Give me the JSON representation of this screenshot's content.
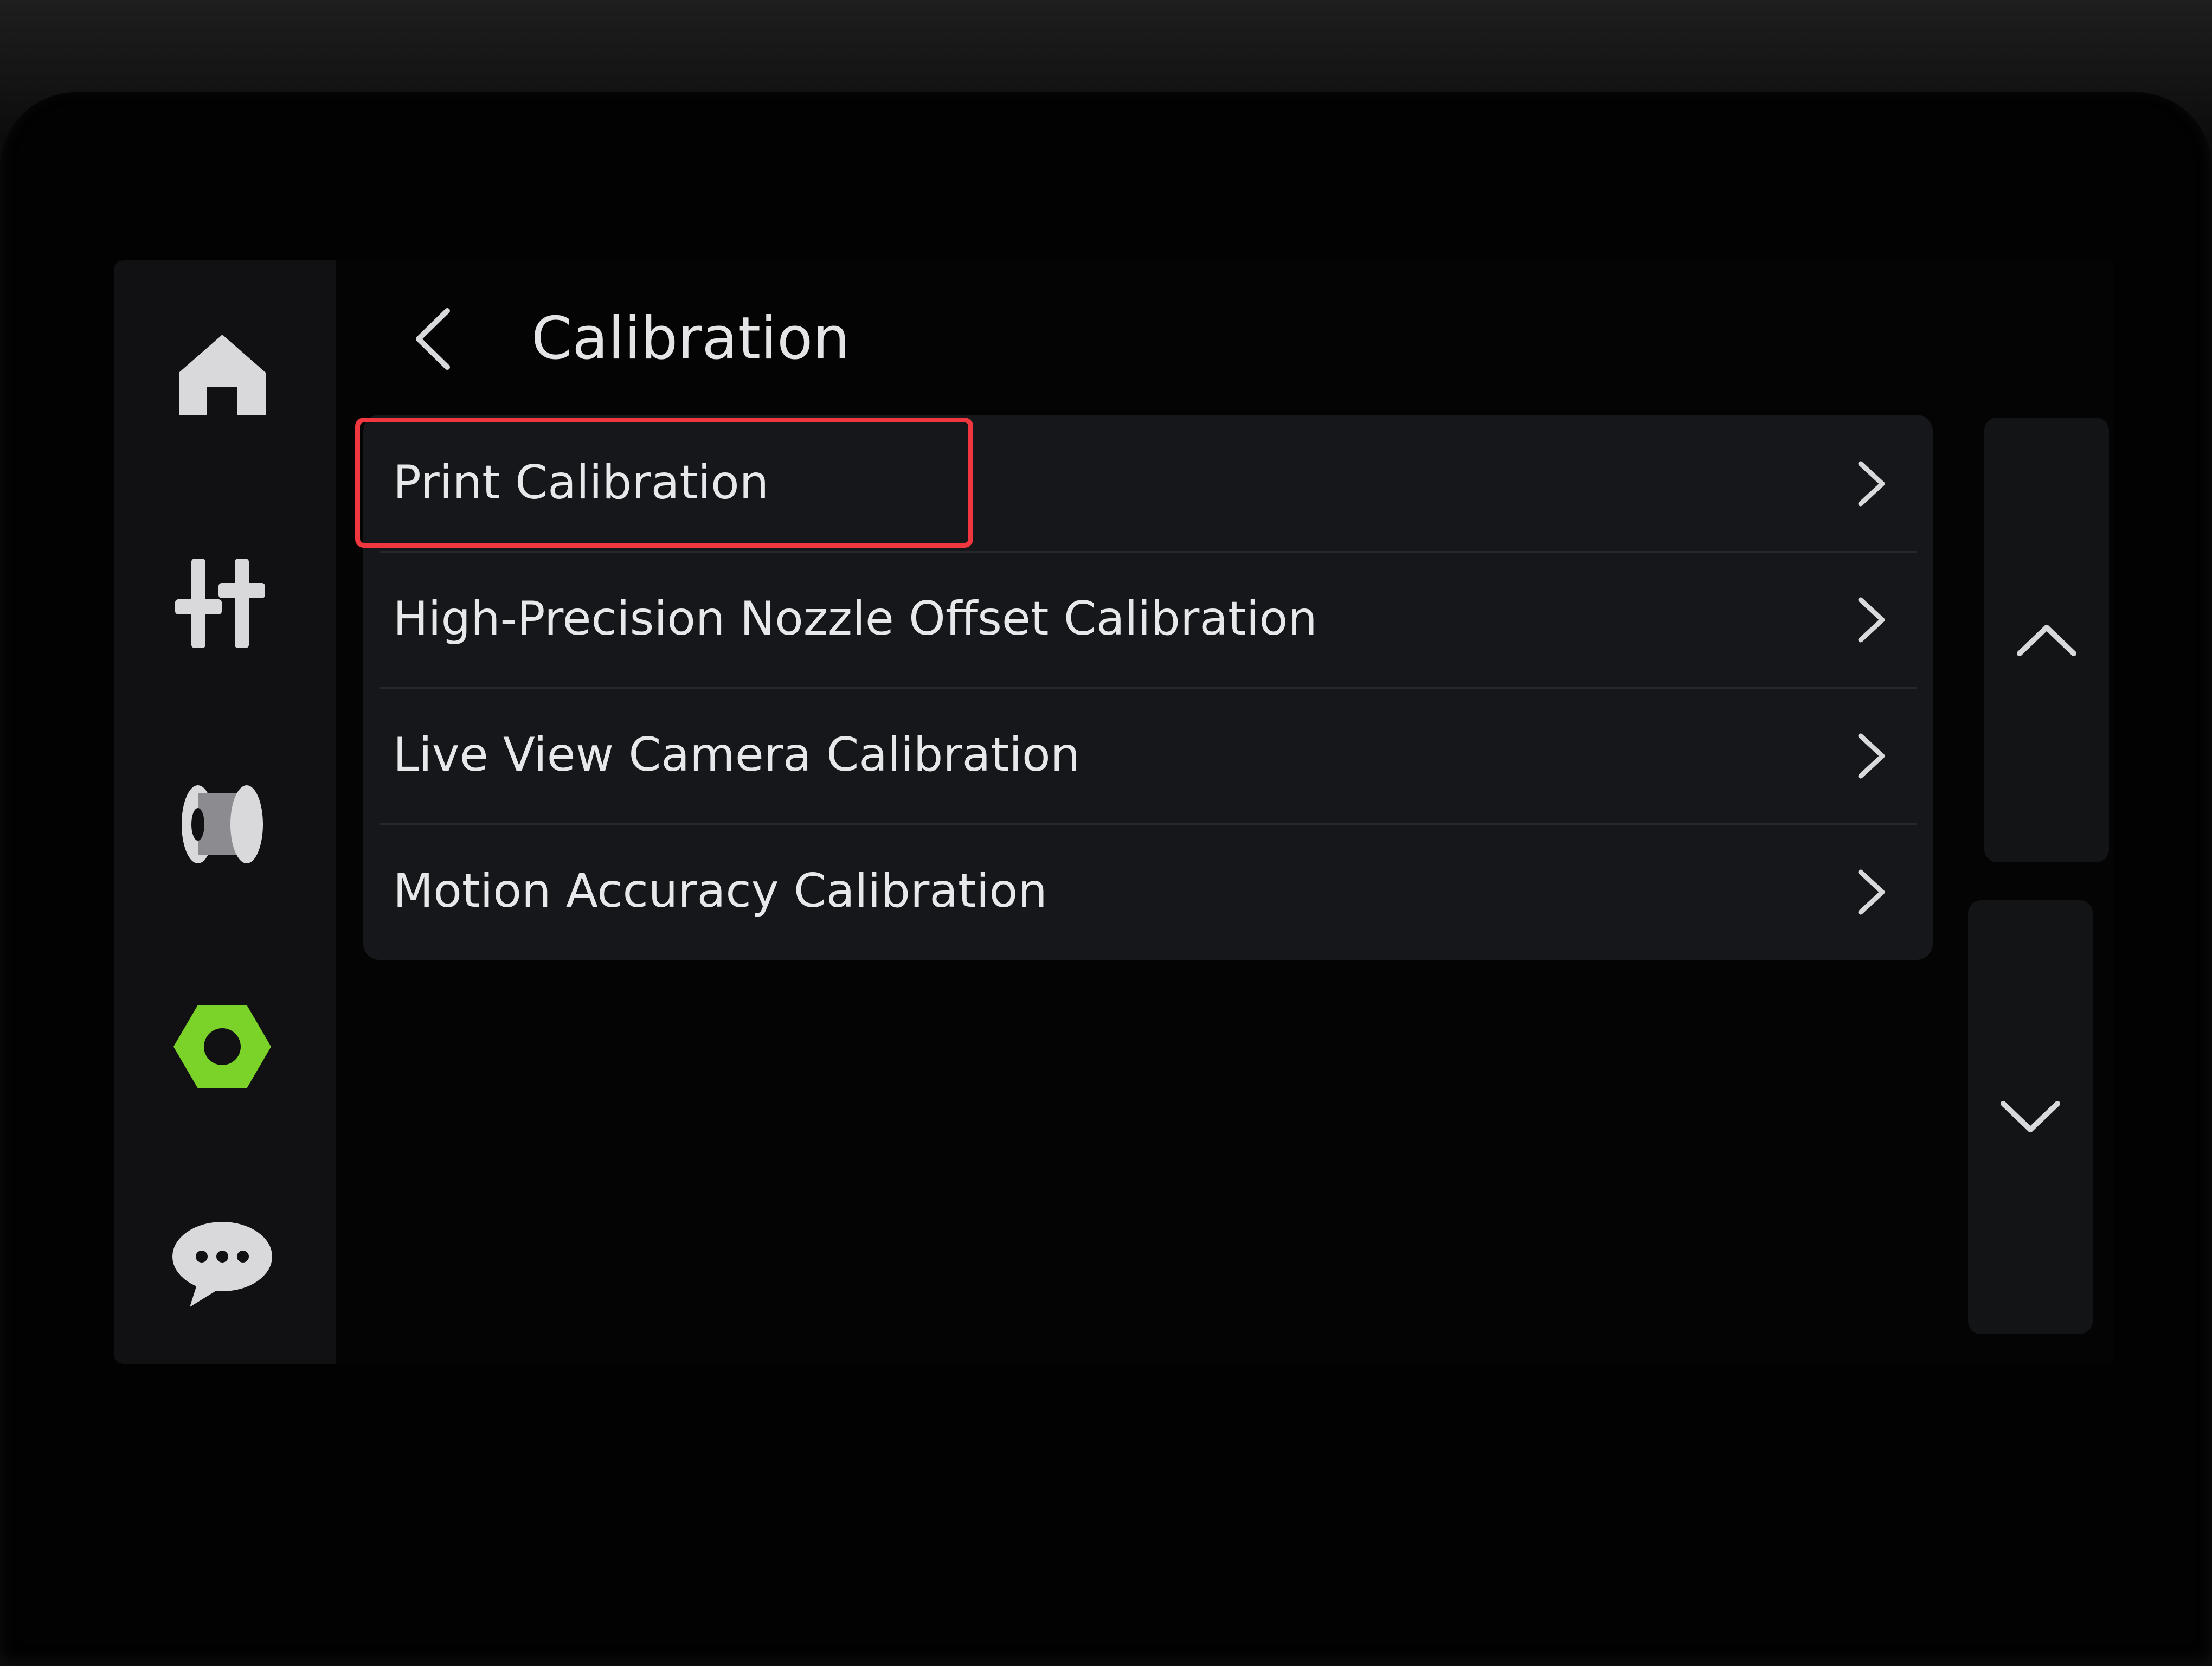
{
  "header": {
    "title": "Calibration"
  },
  "sidebar": {
    "items": [
      {
        "icon": "home-icon",
        "active": false
      },
      {
        "icon": "controls-icon",
        "active": false
      },
      {
        "icon": "filament-spool-icon",
        "active": false
      },
      {
        "icon": "settings-nut-icon",
        "active": true
      },
      {
        "icon": "messages-icon",
        "active": false
      }
    ]
  },
  "menu": {
    "items": [
      {
        "label": "Print Calibration",
        "highlighted": true
      },
      {
        "label": "High-Precision Nozzle Offset Calibration",
        "highlighted": false
      },
      {
        "label": "Live View Camera Calibration",
        "highlighted": false
      },
      {
        "label": "Motion Accuracy Calibration",
        "highlighted": false
      }
    ]
  },
  "scroll": {
    "up_icon": "chevron-up-icon",
    "down_icon": "chevron-down-icon"
  },
  "colors": {
    "accent": "#7bd32a",
    "highlight_box": "#f0373f",
    "text": "#e7e8ea",
    "panel": "#16171a"
  }
}
